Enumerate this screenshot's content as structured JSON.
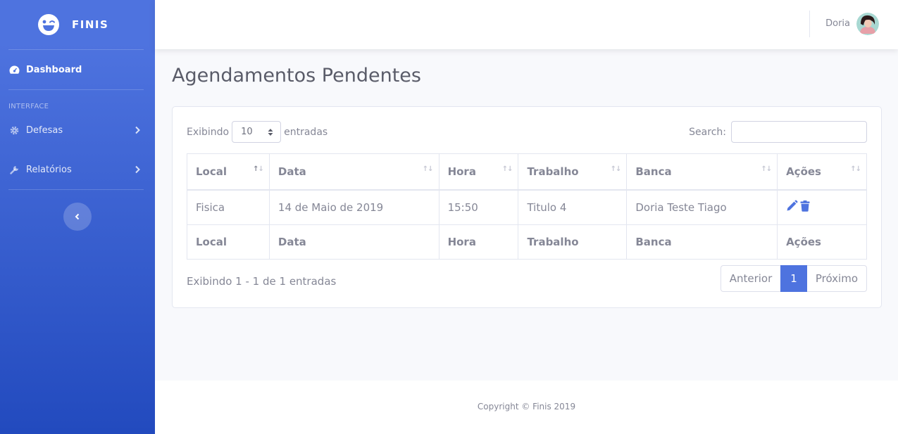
{
  "brand": {
    "name": "FINIS"
  },
  "sidebar": {
    "dashboard_label": "Dashboard",
    "heading": "INTERFACE",
    "items": [
      {
        "label": "Defesas",
        "icon": "gear-icon"
      },
      {
        "label": "Relatórios",
        "icon": "wrench-icon"
      }
    ]
  },
  "topbar": {
    "user_name": "Doria"
  },
  "page": {
    "title": "Agendamentos Pendentes"
  },
  "table_controls": {
    "length_prefix": "Exibindo",
    "length_value": "10",
    "length_suffix": "entradas",
    "search_label": "Search:",
    "search_value": ""
  },
  "table": {
    "columns": [
      "Local",
      "Data",
      "Hora",
      "Trabalho",
      "Banca",
      "Ações"
    ],
    "rows": [
      {
        "local": "Fisica",
        "data": "14 de Maio de 2019",
        "hora": "15:50",
        "trabalho": "Titulo 4",
        "banca": "Doria Teste Tiago"
      }
    ]
  },
  "pagination": {
    "info": "Exibindo 1 - 1 de 1 entradas",
    "prev": "Anterior",
    "current": "1",
    "next": "Próximo"
  },
  "footer": {
    "copyright": "Copyright © Finis 2019"
  },
  "colors": {
    "primary": "#4e73df",
    "primary_dark": "#224abe",
    "text": "#858796"
  }
}
